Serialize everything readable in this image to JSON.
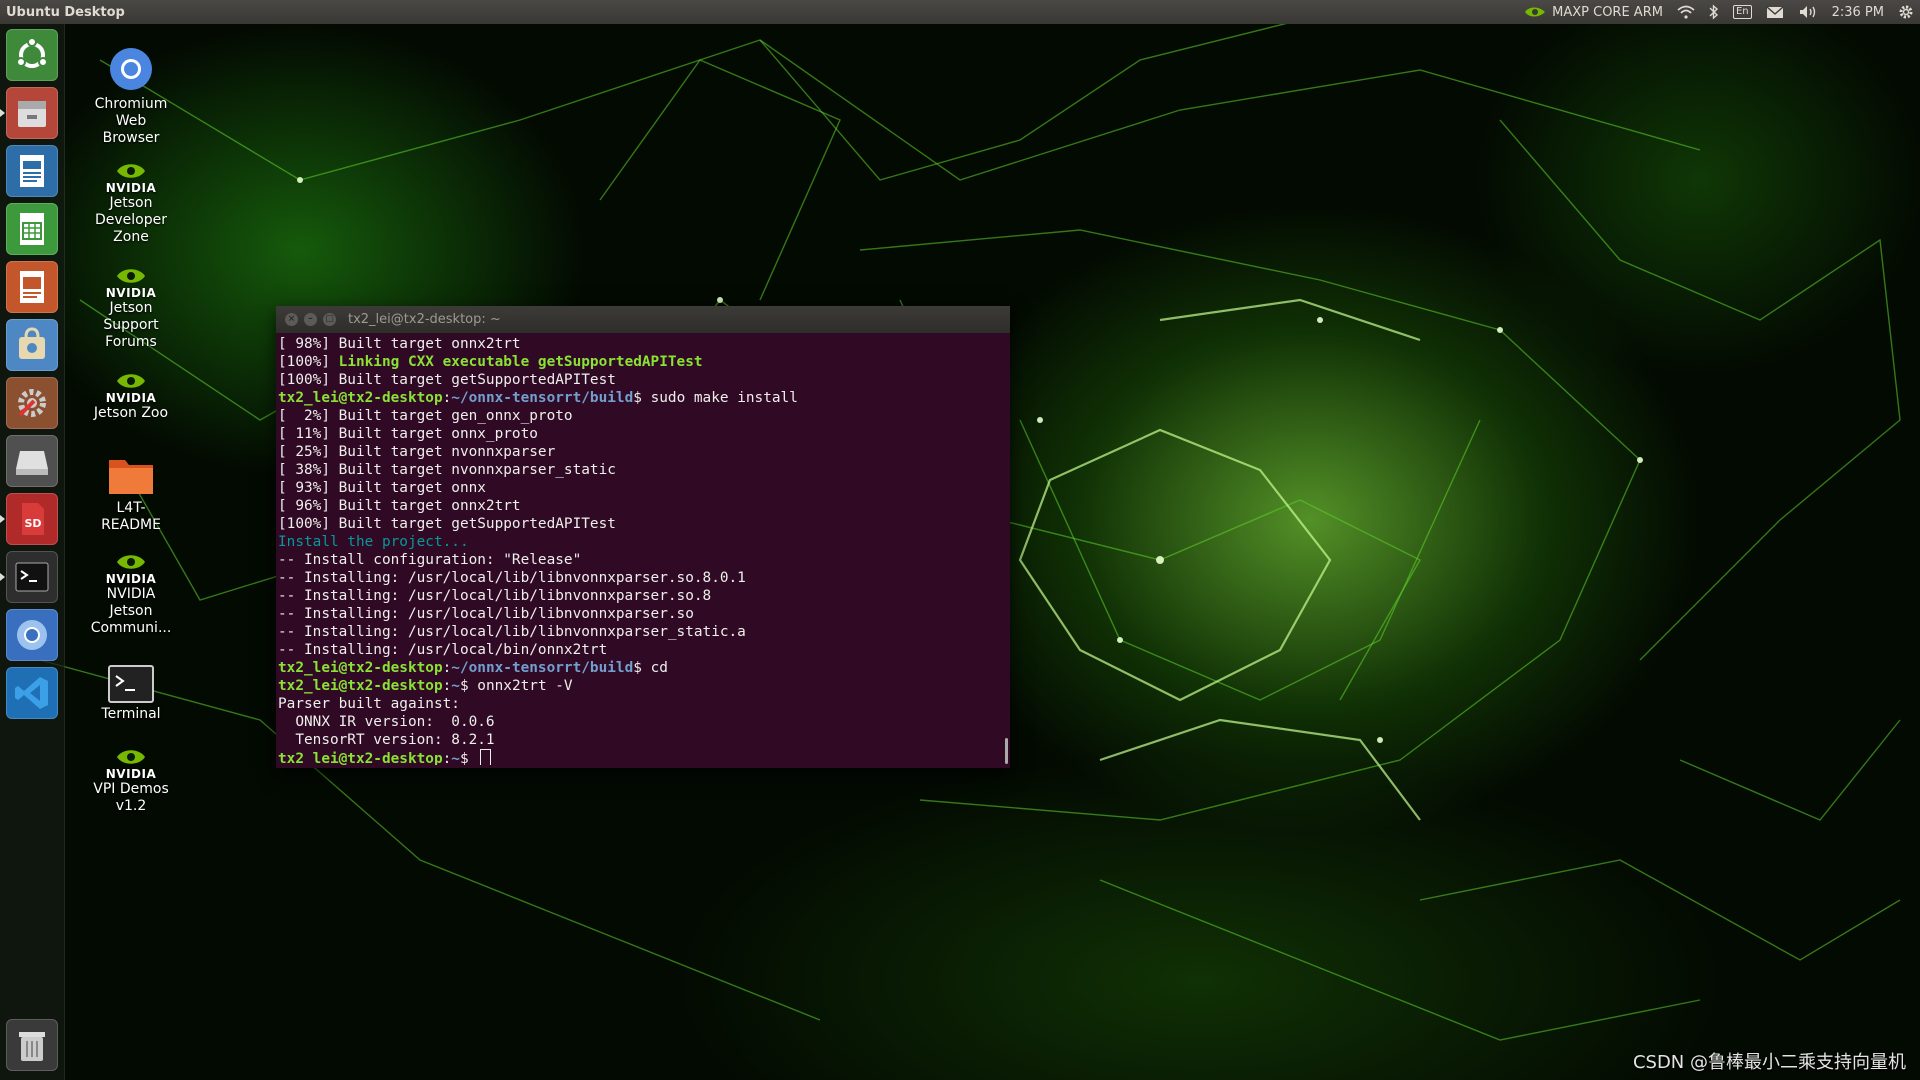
{
  "panel": {
    "title": "Ubuntu Desktop",
    "power_mode": "MAXP CORE ARM",
    "keyboard": "En",
    "time": "2:36 PM"
  },
  "launcher": {
    "items": [
      {
        "icon": "ubuntu-dash-icon"
      },
      {
        "icon": "files-icon"
      },
      {
        "icon": "writer-icon"
      },
      {
        "icon": "calc-icon"
      },
      {
        "icon": "impress-icon"
      },
      {
        "icon": "software-center-icon"
      },
      {
        "icon": "system-settings-icon"
      },
      {
        "icon": "drive-icon"
      },
      {
        "icon": "sd-card-icon"
      },
      {
        "icon": "terminal-icon"
      },
      {
        "icon": "chromium-icon"
      },
      {
        "icon": "vscode-icon"
      },
      {
        "icon": "trash-icon"
      }
    ]
  },
  "desktop": {
    "icons": [
      {
        "label": "Chromium\nWeb\nBrowser"
      },
      {
        "label": "Jetson\nDeveloper\nZone",
        "brand": "NVIDIA"
      },
      {
        "label": "Jetson\nSupport\nForums",
        "brand": "NVIDIA"
      },
      {
        "label": "Jetson Zoo",
        "brand": "NVIDIA"
      },
      {
        "label": "L4T-\nREADME"
      },
      {
        "label": "NVIDIA\nJetson\nCommuni...",
        "brand": "NVIDIA"
      },
      {
        "label": "Terminal"
      },
      {
        "label": "VPI Demos\nv1.2",
        "brand": "NVIDIA"
      }
    ]
  },
  "terminal": {
    "title": "tx2_lei@tx2-desktop: ~",
    "lines": [
      [
        {
          "t": "[ 98%] Built target onnx2trt"
        }
      ],
      [
        {
          "t": "[100%] "
        },
        {
          "t": "Linking CXX executable getSupportedAPITest",
          "c": "c-green"
        }
      ],
      [
        {
          "t": "[100%] Built target getSupportedAPITest"
        }
      ],
      [
        {
          "t": "tx2_lei@tx2-desktop",
          "c": "c-green"
        },
        {
          "t": ":"
        },
        {
          "t": "~/onnx-tensorrt/build",
          "c": "c-blue"
        },
        {
          "t": "$ sudo make install"
        }
      ],
      [
        {
          "t": "[  2%] Built target gen_onnx_proto"
        }
      ],
      [
        {
          "t": "[ 11%] Built target onnx_proto"
        }
      ],
      [
        {
          "t": "[ 25%] Built target nvonnxparser"
        }
      ],
      [
        {
          "t": "[ 38%] Built target nvonnxparser_static"
        }
      ],
      [
        {
          "t": "[ 93%] Built target onnx"
        }
      ],
      [
        {
          "t": "[ 96%] Built target onnx2trt"
        }
      ],
      [
        {
          "t": "[100%] Built target getSupportedAPITest"
        }
      ],
      [
        {
          "t": "Install the project...",
          "c": "c-cyan"
        }
      ],
      [
        {
          "t": "-- Install configuration: \"Release\""
        }
      ],
      [
        {
          "t": "-- Installing: /usr/local/lib/libnvonnxparser.so.8.0.1"
        }
      ],
      [
        {
          "t": "-- Installing: /usr/local/lib/libnvonnxparser.so.8"
        }
      ],
      [
        {
          "t": "-- Installing: /usr/local/lib/libnvonnxparser.so"
        }
      ],
      [
        {
          "t": "-- Installing: /usr/local/lib/libnvonnxparser_static.a"
        }
      ],
      [
        {
          "t": "-- Installing: /usr/local/bin/onnx2trt"
        }
      ],
      [
        {
          "t": "tx2_lei@tx2-desktop",
          "c": "c-green"
        },
        {
          "t": ":"
        },
        {
          "t": "~/onnx-tensorrt/build",
          "c": "c-blue"
        },
        {
          "t": "$ cd"
        }
      ],
      [
        {
          "t": "tx2_lei@tx2-desktop",
          "c": "c-green"
        },
        {
          "t": ":"
        },
        {
          "t": "~",
          "c": "c-blue"
        },
        {
          "t": "$ onnx2trt -V"
        }
      ],
      [
        {
          "t": "Parser built against:"
        }
      ],
      [
        {
          "t": "  ONNX IR version:  0.0.6"
        }
      ],
      [
        {
          "t": "  TensorRT version: 8.2.1"
        }
      ],
      [
        {
          "t": "tx2_lei@tx2-desktop",
          "c": "c-green"
        },
        {
          "t": ":"
        },
        {
          "t": "~",
          "c": "c-blue"
        },
        {
          "t": "$ "
        },
        {
          "cursor": true
        }
      ]
    ]
  },
  "watermark": "CSDN @鲁棒最小二乘支持向量机"
}
